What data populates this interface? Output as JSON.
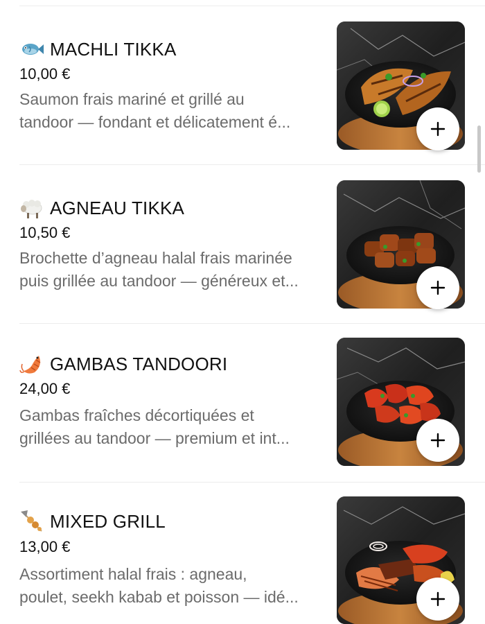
{
  "menu": {
    "items": [
      {
        "icon": "fish-icon",
        "name": "MACHLI TIKKA",
        "price": "10,00 €",
        "desc_line1": "Saumon frais mariné et grillé au",
        "desc_line2": "tandoor — fondant et délicatement é...",
        "image": "salmon-tikka-plate"
      },
      {
        "icon": "sheep-icon",
        "name": "AGNEAU TIKKA",
        "price": "10,50 €",
        "desc_line1": "Brochette d’agneau halal frais marinée",
        "desc_line2": "puis grillée au tandoor — généreux et...",
        "image": "lamb-tikka-plate"
      },
      {
        "icon": "shrimp-icon",
        "name": "GAMBAS TANDOORI",
        "price": "24,00 €",
        "desc_line1": "Gambas fraîches décortiquées et",
        "desc_line2": "grillées au tandoor — premium et int...",
        "image": "tandoori-prawns-plate"
      },
      {
        "icon": "skewer-icon",
        "name": "MIXED GRILL",
        "price": "13,00 €",
        "desc_line1": "Assortiment halal frais : agneau,",
        "desc_line2": "poulet, seekh kabab et poisson — idé...",
        "image": "mixed-grill-plate"
      }
    ],
    "add_icon": "plus-icon"
  },
  "colors": {
    "text_primary": "#111111",
    "text_secondary": "#6b6b6b",
    "divider": "#ececec",
    "scrollbar": "#c8c8c8"
  }
}
